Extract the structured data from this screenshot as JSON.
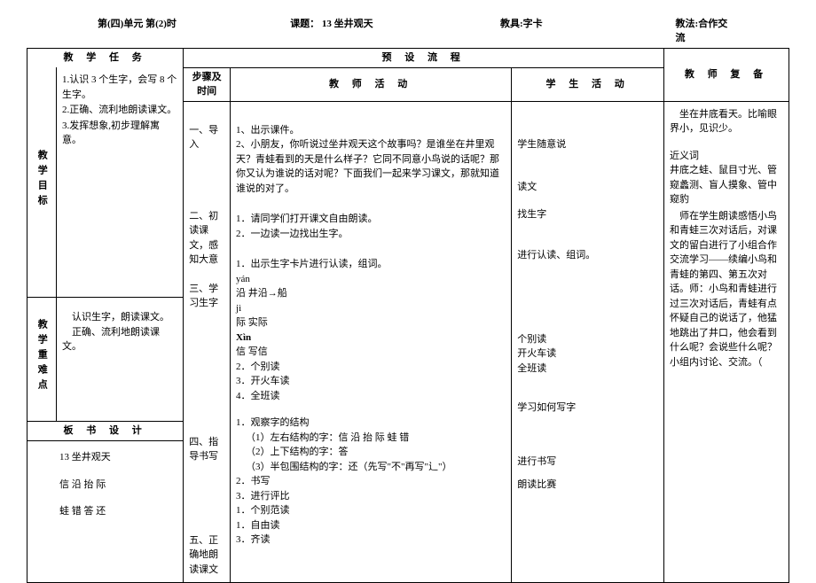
{
  "header": {
    "unit": "第(四)单元               第(2)时",
    "topic": "课题：  13 坐井观天",
    "aid": "教具:字卡",
    "method": "教法:合作交流"
  },
  "labels": {
    "task": "教 学 任 务",
    "flow": "预 设 流 程",
    "notes": "教 师 复 备",
    "goal": "教学目标",
    "keypoint": "教学重难点",
    "board": "板 书 设 计",
    "steps": "步骤及时间",
    "teacher_act": "教 师 活 动",
    "student_act": "学 生 活 动"
  },
  "goals": {
    "l1": "1.认识 3 个生字，会写 8 个生字。",
    "l2": "2.正确、流利地朗读课文。",
    "l3": "3.发挥想象,初步理解寓意。"
  },
  "keypoints": {
    "l1": "认识生字，朗读课文。",
    "l2": "正确、流利地朗读课文。"
  },
  "board": {
    "l1": "13 坐井观天",
    "l2": "信   沿   抬   际",
    "l3": "蛙   错   答   还"
  },
  "steps": {
    "s1": "一、导入",
    "s2": "二、初读课文，感知大意",
    "s3": "三、学习生字",
    "s4": "四、指导书写",
    "s5": "五、正确地朗读课文"
  },
  "teacher": {
    "t1a": "1、出示课件。",
    "t1b": "2、小朋友，你听说过坐井观天这个故事吗？是谁坐在井里观天？青蛙看到的天是什么样子？它同不同意小鸟说的话呢？那你又认为谁说的话对呢？下面我们一起来学习课文，那就知道谁说的对了。",
    "t2a": "1．请同学们打开课文自由朗读。",
    "t2b": "2．一边读一边找出生字。",
    "t3a": "1．出示生字卡片进行认读，组词。",
    "t3b": "yán",
    "t3c": "沿     井沿→船",
    "t3d": "jì",
    "t3e": "际     实际",
    "t3f": "Xìn",
    "t3g": "信     写信",
    "t3h": "2．个别读",
    "t3i": "3．开火车读",
    "t3j": "4．全班读",
    "t4a": "1．观察字的结构",
    "t4b": "（1）左右结构的字：信   沿   抬   际  蛙   错",
    "t4c": "（2）上下结构的字：答",
    "t4d": "（3）半包围结构的字：还（先写\"不\"再写\"辶\"）",
    "t4e": "2．书写",
    "t4f": "3．进行评比",
    "t5a": "1．个别范读",
    "t5b": "1．自由读",
    "t5c": "3．齐读"
  },
  "student": {
    "s1a": "学生随意说",
    "s2a": "读文",
    "s2b": "找生字",
    "s3a": "进行认读、组词。",
    "s3b": "个别读",
    "s3c": "开火车读",
    "s3d": "全班读",
    "s4a": "学习如何写字",
    "s4b": "进行书写",
    "s5a": "朗读比赛"
  },
  "notes": {
    "n0": "坐在井底看天。比喻眼界小，见识少。",
    "n1": "近义词",
    "n2": "井底之蛙、鼠目寸光、管窥蠡测、盲人摸象、管中窥豹",
    "n3": "师在学生朗读感悟小鸟和青蛙三次对话后，对课文的留白进行了小组合作交流学习——续编小鸟和青蛙的第四、第五次对话。师：小鸟和青蛙进行过三次对话后，青蛙有点怀疑自己的说话了，他猛地跳出了井口，他会看到什么呢？会说些什么呢？小组内讨论、交流。（"
  }
}
